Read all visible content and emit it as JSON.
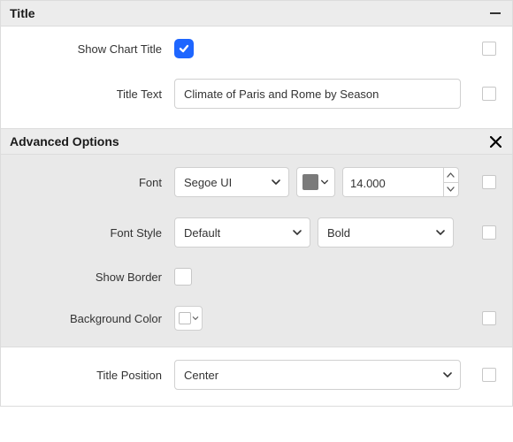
{
  "sections": {
    "title_header": "Title",
    "advanced_header": "Advanced Options"
  },
  "title": {
    "show_label": "Show Chart Title",
    "show_checked": true,
    "text_label": "Title Text",
    "text_value": "Climate of Paris and Rome by Season"
  },
  "advanced": {
    "font_label": "Font",
    "font_family": "Segoe UI",
    "font_color": "#7a7a7a",
    "font_size": "14.000",
    "font_style_label": "Font Style",
    "font_style": "Default",
    "font_weight": "Bold",
    "show_border_label": "Show Border",
    "show_border_checked": false,
    "bg_label": "Background Color",
    "bg_value": ""
  },
  "position": {
    "label": "Title Position",
    "value": "Center"
  }
}
